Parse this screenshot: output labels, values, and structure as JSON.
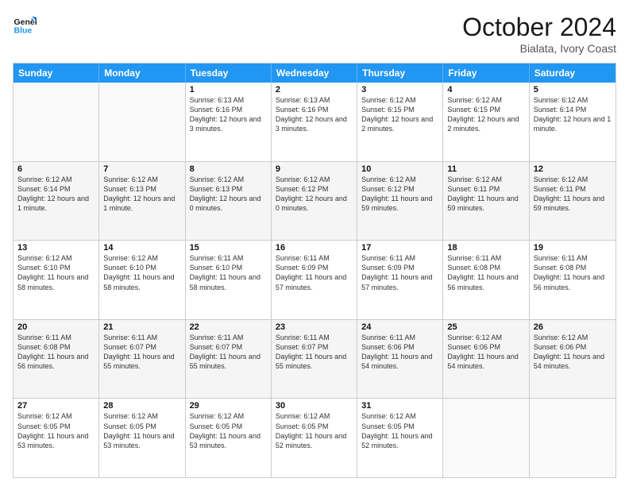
{
  "logo": {
    "line1": "General",
    "line2": "Blue"
  },
  "header": {
    "month": "October 2024",
    "location": "Bialata, Ivory Coast"
  },
  "weekdays": [
    "Sunday",
    "Monday",
    "Tuesday",
    "Wednesday",
    "Thursday",
    "Friday",
    "Saturday"
  ],
  "rows": [
    [
      {
        "day": "",
        "sunrise": "",
        "sunset": "",
        "daylight": "",
        "empty": true
      },
      {
        "day": "",
        "sunrise": "",
        "sunset": "",
        "daylight": "",
        "empty": true
      },
      {
        "day": "1",
        "sunrise": "Sunrise: 6:13 AM",
        "sunset": "Sunset: 6:16 PM",
        "daylight": "Daylight: 12 hours and 3 minutes."
      },
      {
        "day": "2",
        "sunrise": "Sunrise: 6:13 AM",
        "sunset": "Sunset: 6:16 PM",
        "daylight": "Daylight: 12 hours and 3 minutes."
      },
      {
        "day": "3",
        "sunrise": "Sunrise: 6:12 AM",
        "sunset": "Sunset: 6:15 PM",
        "daylight": "Daylight: 12 hours and 2 minutes."
      },
      {
        "day": "4",
        "sunrise": "Sunrise: 6:12 AM",
        "sunset": "Sunset: 6:15 PM",
        "daylight": "Daylight: 12 hours and 2 minutes."
      },
      {
        "day": "5",
        "sunrise": "Sunrise: 6:12 AM",
        "sunset": "Sunset: 6:14 PM",
        "daylight": "Daylight: 12 hours and 1 minute."
      }
    ],
    [
      {
        "day": "6",
        "sunrise": "Sunrise: 6:12 AM",
        "sunset": "Sunset: 6:14 PM",
        "daylight": "Daylight: 12 hours and 1 minute."
      },
      {
        "day": "7",
        "sunrise": "Sunrise: 6:12 AM",
        "sunset": "Sunset: 6:13 PM",
        "daylight": "Daylight: 12 hours and 1 minute."
      },
      {
        "day": "8",
        "sunrise": "Sunrise: 6:12 AM",
        "sunset": "Sunset: 6:13 PM",
        "daylight": "Daylight: 12 hours and 0 minutes."
      },
      {
        "day": "9",
        "sunrise": "Sunrise: 6:12 AM",
        "sunset": "Sunset: 6:12 PM",
        "daylight": "Daylight: 12 hours and 0 minutes."
      },
      {
        "day": "10",
        "sunrise": "Sunrise: 6:12 AM",
        "sunset": "Sunset: 6:12 PM",
        "daylight": "Daylight: 11 hours and 59 minutes."
      },
      {
        "day": "11",
        "sunrise": "Sunrise: 6:12 AM",
        "sunset": "Sunset: 6:11 PM",
        "daylight": "Daylight: 11 hours and 59 minutes."
      },
      {
        "day": "12",
        "sunrise": "Sunrise: 6:12 AM",
        "sunset": "Sunset: 6:11 PM",
        "daylight": "Daylight: 11 hours and 59 minutes."
      }
    ],
    [
      {
        "day": "13",
        "sunrise": "Sunrise: 6:12 AM",
        "sunset": "Sunset: 6:10 PM",
        "daylight": "Daylight: 11 hours and 58 minutes."
      },
      {
        "day": "14",
        "sunrise": "Sunrise: 6:12 AM",
        "sunset": "Sunset: 6:10 PM",
        "daylight": "Daylight: 11 hours and 58 minutes."
      },
      {
        "day": "15",
        "sunrise": "Sunrise: 6:11 AM",
        "sunset": "Sunset: 6:10 PM",
        "daylight": "Daylight: 11 hours and 58 minutes."
      },
      {
        "day": "16",
        "sunrise": "Sunrise: 6:11 AM",
        "sunset": "Sunset: 6:09 PM",
        "daylight": "Daylight: 11 hours and 57 minutes."
      },
      {
        "day": "17",
        "sunrise": "Sunrise: 6:11 AM",
        "sunset": "Sunset: 6:09 PM",
        "daylight": "Daylight: 11 hours and 57 minutes."
      },
      {
        "day": "18",
        "sunrise": "Sunrise: 6:11 AM",
        "sunset": "Sunset: 6:08 PM",
        "daylight": "Daylight: 11 hours and 56 minutes."
      },
      {
        "day": "19",
        "sunrise": "Sunrise: 6:11 AM",
        "sunset": "Sunset: 6:08 PM",
        "daylight": "Daylight: 11 hours and 56 minutes."
      }
    ],
    [
      {
        "day": "20",
        "sunrise": "Sunrise: 6:11 AM",
        "sunset": "Sunset: 6:08 PM",
        "daylight": "Daylight: 11 hours and 56 minutes."
      },
      {
        "day": "21",
        "sunrise": "Sunrise: 6:11 AM",
        "sunset": "Sunset: 6:07 PM",
        "daylight": "Daylight: 11 hours and 55 minutes."
      },
      {
        "day": "22",
        "sunrise": "Sunrise: 6:11 AM",
        "sunset": "Sunset: 6:07 PM",
        "daylight": "Daylight: 11 hours and 55 minutes."
      },
      {
        "day": "23",
        "sunrise": "Sunrise: 6:11 AM",
        "sunset": "Sunset: 6:07 PM",
        "daylight": "Daylight: 11 hours and 55 minutes."
      },
      {
        "day": "24",
        "sunrise": "Sunrise: 6:11 AM",
        "sunset": "Sunset: 6:06 PM",
        "daylight": "Daylight: 11 hours and 54 minutes."
      },
      {
        "day": "25",
        "sunrise": "Sunrise: 6:12 AM",
        "sunset": "Sunset: 6:06 PM",
        "daylight": "Daylight: 11 hours and 54 minutes."
      },
      {
        "day": "26",
        "sunrise": "Sunrise: 6:12 AM",
        "sunset": "Sunset: 6:06 PM",
        "daylight": "Daylight: 11 hours and 54 minutes."
      }
    ],
    [
      {
        "day": "27",
        "sunrise": "Sunrise: 6:12 AM",
        "sunset": "Sunset: 6:05 PM",
        "daylight": "Daylight: 11 hours and 53 minutes."
      },
      {
        "day": "28",
        "sunrise": "Sunrise: 6:12 AM",
        "sunset": "Sunset: 6:05 PM",
        "daylight": "Daylight: 11 hours and 53 minutes."
      },
      {
        "day": "29",
        "sunrise": "Sunrise: 6:12 AM",
        "sunset": "Sunset: 6:05 PM",
        "daylight": "Daylight: 11 hours and 53 minutes."
      },
      {
        "day": "30",
        "sunrise": "Sunrise: 6:12 AM",
        "sunset": "Sunset: 6:05 PM",
        "daylight": "Daylight: 11 hours and 52 minutes."
      },
      {
        "day": "31",
        "sunrise": "Sunrise: 6:12 AM",
        "sunset": "Sunset: 6:05 PM",
        "daylight": "Daylight: 11 hours and 52 minutes."
      },
      {
        "day": "",
        "sunrise": "",
        "sunset": "",
        "daylight": "",
        "empty": true
      },
      {
        "day": "",
        "sunrise": "",
        "sunset": "",
        "daylight": "",
        "empty": true
      }
    ]
  ]
}
